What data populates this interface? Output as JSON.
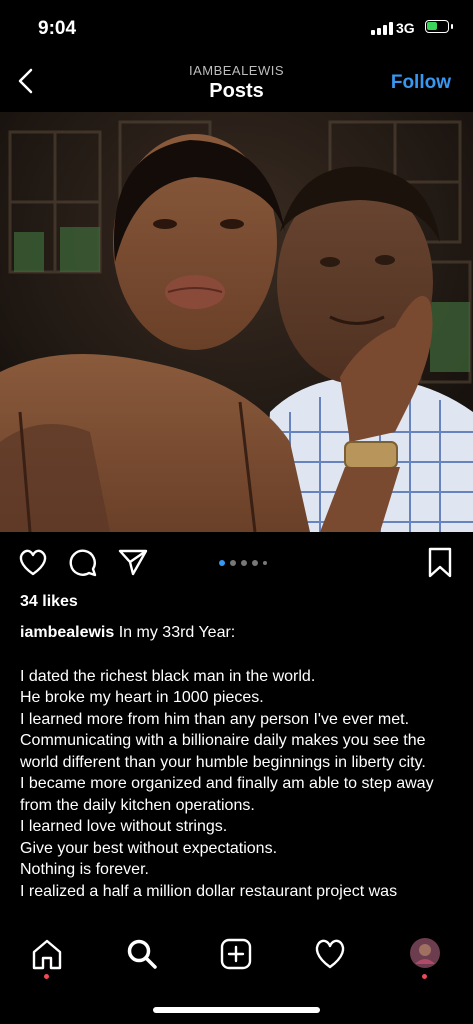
{
  "status_bar": {
    "time": "9:04",
    "network": "3G"
  },
  "header": {
    "username": "IAMBEALEWIS",
    "title": "Posts",
    "follow_label": "Follow"
  },
  "post": {
    "likes": "34 likes",
    "caption_user": "iambealewis",
    "caption_first": "In my 33rd Year:",
    "caption_lines": [
      "I dated the richest black man in the world.",
      "He broke my heart in 1000 pieces.",
      "I learned more from him than any person I've ever met. Communicating with a billionaire daily makes you see the world different than your humble beginnings in liberty city.",
      "I became more organized and finally am able to step away from the daily kitchen operations.",
      "I learned love without strings.",
      "Give your best without expectations.",
      "Nothing is forever.",
      "I realized a half a million dollar restaurant project was"
    ],
    "carousel": {
      "count": 5,
      "active_index": 0
    }
  },
  "icons": {
    "back": "chevron-left-icon",
    "like": "heart-icon",
    "comment": "comment-icon",
    "share": "paper-plane-icon",
    "save": "bookmark-icon",
    "nav": [
      "home-icon",
      "search-icon",
      "add-post-icon",
      "activity-heart-icon",
      "profile-avatar"
    ]
  },
  "colors": {
    "accent": "#3897f0",
    "notification": "#ed4956",
    "battery": "#3cd65a"
  }
}
